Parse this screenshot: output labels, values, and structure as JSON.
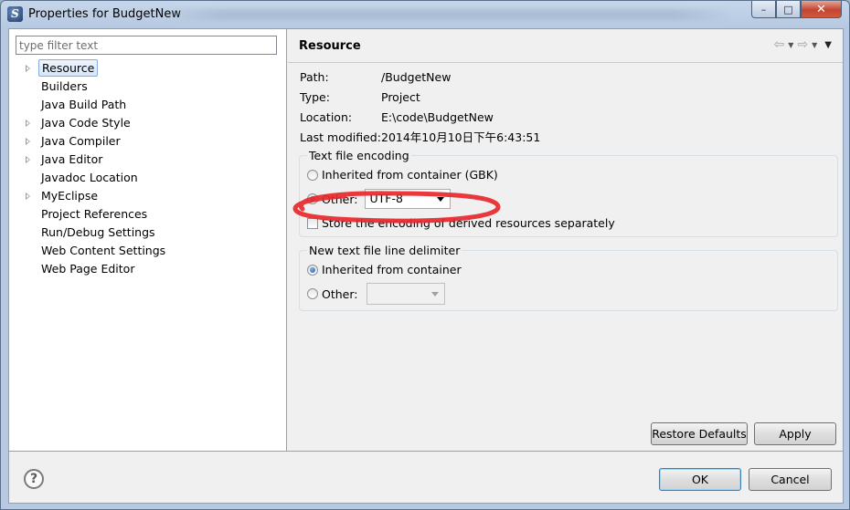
{
  "window": {
    "title": "Properties for BudgetNew",
    "app_icon_letter": "S",
    "controls": {
      "minimize": "–",
      "maximize": "□",
      "close": "✕"
    }
  },
  "filter": {
    "placeholder": "type filter text",
    "value": ""
  },
  "tree": {
    "items": [
      {
        "label": "Resource",
        "expandable": true,
        "selected": true
      },
      {
        "label": "Builders",
        "expandable": false
      },
      {
        "label": "Java Build Path",
        "expandable": false
      },
      {
        "label": "Java Code Style",
        "expandable": true
      },
      {
        "label": "Java Compiler",
        "expandable": true
      },
      {
        "label": "Java Editor",
        "expandable": true
      },
      {
        "label": "Javadoc Location",
        "expandable": false
      },
      {
        "label": "MyEclipse",
        "expandable": true
      },
      {
        "label": "Project References",
        "expandable": false
      },
      {
        "label": "Run/Debug Settings",
        "expandable": false
      },
      {
        "label": "Web Content Settings",
        "expandable": false
      },
      {
        "label": "Web Page Editor",
        "expandable": false
      }
    ]
  },
  "page": {
    "title": "Resource",
    "nav": {
      "back": "⇦",
      "forward": "⇨",
      "dropdown": "▼",
      "menu": "▼"
    },
    "props": [
      {
        "key": "Path:",
        "value": "/BudgetNew"
      },
      {
        "key": "Type:",
        "value": "Project"
      },
      {
        "key": "Location:",
        "value": "E:\\code\\BudgetNew"
      },
      {
        "key": "Last modified:",
        "value": "2014年10月10日下午6:43:51"
      }
    ],
    "encoding": {
      "title": "Text file encoding",
      "inherited_label": "Inherited from container (GBK)",
      "other_label": "Other:",
      "other_value": "UTF-8",
      "selected": "other",
      "store_label": "Store the encoding of derived resources separately",
      "store_checked": false
    },
    "delimiter": {
      "title": "New text file line delimiter",
      "inherited_label": "Inherited from container",
      "other_label": "Other:",
      "other_value": "",
      "selected": "inherited"
    },
    "annotation_color": "#e8272b"
  },
  "buttons": {
    "restore_defaults": "Restore Defaults",
    "apply": "Apply",
    "ok": "OK",
    "cancel": "Cancel",
    "help": "?"
  }
}
